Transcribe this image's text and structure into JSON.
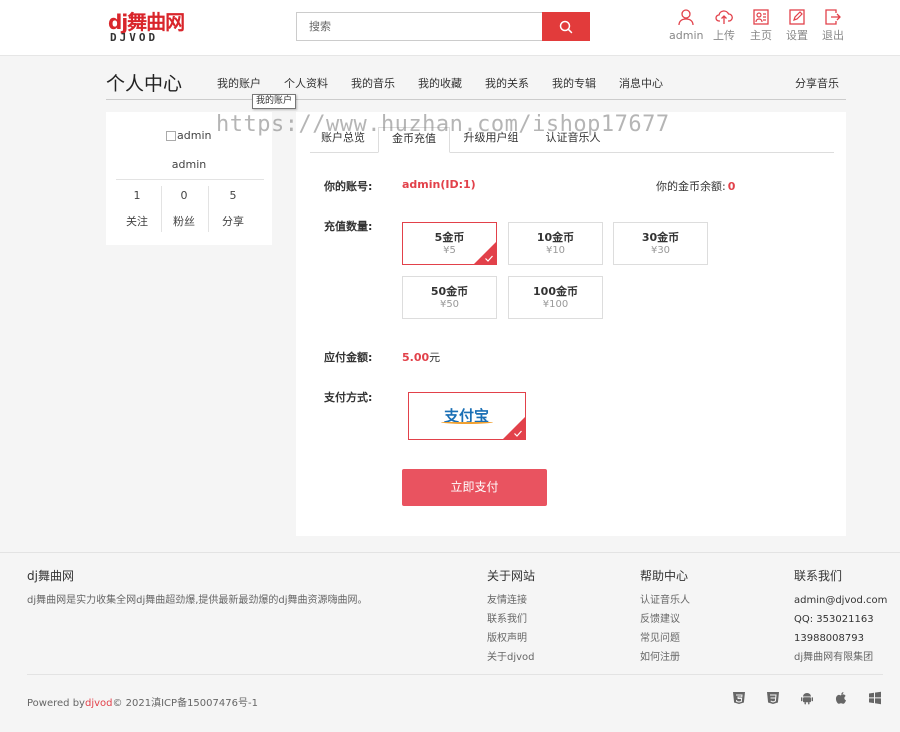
{
  "header": {
    "logo_main": "dj舞曲网",
    "logo_sub": "DJVOD",
    "search_placeholder": "搜索",
    "nav": [
      {
        "label": "admin",
        "icon": "user-icon"
      },
      {
        "label": "上传",
        "icon": "upload-cloud-icon"
      },
      {
        "label": "主页",
        "icon": "homepage-icon"
      },
      {
        "label": "设置",
        "icon": "edit-icon"
      },
      {
        "label": "退出",
        "icon": "logout-icon"
      }
    ]
  },
  "subnav": {
    "title": "个人中心",
    "items": [
      "我的账户",
      "个人资料",
      "我的音乐",
      "我的收藏",
      "我的关系",
      "我的专辑",
      "消息中心"
    ],
    "share": "分享音乐",
    "tooltip": "我的账户"
  },
  "watermark": "https://www.huzhan.com/ishop17677",
  "profile": {
    "avatar_alt": "admin",
    "name": "admin",
    "stats": [
      {
        "value": "1",
        "label": "关注"
      },
      {
        "value": "0",
        "label": "粉丝"
      },
      {
        "value": "5",
        "label": "分享"
      }
    ]
  },
  "recharge": {
    "tabs": [
      "账户总览",
      "金币充值",
      "升级用户组",
      "认证音乐人"
    ],
    "active_tab": 1,
    "account_label": "你的账号:",
    "account_value": "admin(ID:1)",
    "balance_label": "你的金币余额:",
    "balance_value": "0",
    "qty_label": "充值数量:",
    "options": [
      {
        "coins": "5金币",
        "price": "¥5"
      },
      {
        "coins": "10金币",
        "price": "¥10"
      },
      {
        "coins": "30金币",
        "price": "¥30"
      },
      {
        "coins": "50金币",
        "price": "¥50"
      },
      {
        "coins": "100金币",
        "price": "¥100"
      }
    ],
    "selected_option": 0,
    "due_label": "应付金额:",
    "due_value": "5.00",
    "due_unit": "元",
    "method_label": "支付方式:",
    "method_logo": "支付宝",
    "pay_button": "立即支付"
  },
  "footer": {
    "brand": "dj舞曲网",
    "desc": "dj舞曲网是实力收集全网dj舞曲超劲爆,提供最新最劲爆的dj舞曲资源嗨曲网。",
    "cols": [
      {
        "title": "关于网站",
        "links": [
          "友情连接",
          "联系我们",
          "版权声明",
          "关于djvod"
        ]
      },
      {
        "title": "帮助中心",
        "links": [
          "认证音乐人",
          "反馈建议",
          "常见问题",
          "如何注册"
        ]
      },
      {
        "title": "联系我们",
        "links": [
          "admin@djvod.com",
          "QQ: 353021163",
          "13988008793",
          "dj舞曲网有限集团"
        ]
      }
    ],
    "copyright_prefix": "Powered by",
    "copyright_link": "djvod",
    "copyright_suffix": "© 2021滇ICP备15007476号-1",
    "icons": [
      "html5-icon",
      "css3-icon",
      "android-icon",
      "apple-icon",
      "windows-icon"
    ]
  },
  "colors": {
    "accent": "#e2414a",
    "search_button": "#e23b3b",
    "pay_button": "#e95360"
  }
}
